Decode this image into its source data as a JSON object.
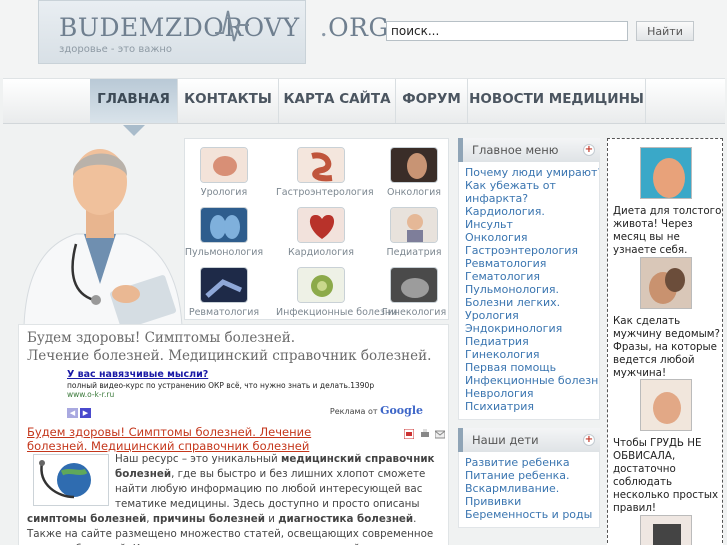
{
  "header": {
    "logo_text": "BUDEMZDOROVY",
    "logo_suffix": "ORG",
    "slogan": "здоровье - это важно",
    "search_value": "поиск...",
    "search_button": "Найти"
  },
  "nav": {
    "items": [
      {
        "label": "ГЛАВНАЯ",
        "active": true
      },
      {
        "label": "КОНТАКТЫ",
        "active": false
      },
      {
        "label": "КАРТА САЙТА",
        "active": false
      },
      {
        "label": "ФОРУМ",
        "active": false
      },
      {
        "label": "НОВОСТИ МЕДИЦИНЫ",
        "active": false
      }
    ]
  },
  "categories": [
    {
      "label": "Урология",
      "icon": "urology-icon"
    },
    {
      "label": "Гастроэнтерология",
      "icon": "gastro-icon"
    },
    {
      "label": "Онкология",
      "icon": "oncology-icon"
    },
    {
      "label": "Пульмонология",
      "icon": "lungs-icon"
    },
    {
      "label": "Кардиология",
      "icon": "heart-icon"
    },
    {
      "label": "Педиатрия",
      "icon": "child-icon"
    },
    {
      "label": "Ревматология",
      "icon": "joint-icon"
    },
    {
      "label": "Инфекционные болезни",
      "icon": "virus-icon"
    },
    {
      "label": "Гинекология",
      "icon": "gynecology-icon"
    }
  ],
  "main": {
    "hero_title_line1": "Будем здоровы! Симптомы болезней.",
    "hero_title_line2": "Лечение болезней. Медицинский справочник болезней.",
    "ad": {
      "title": "У вас навязчивые мысли?",
      "text": "полный видео-курс по устранению ОКР всё, что нужно знать и делать.1390р",
      "url": "www.o-k-r.ru",
      "google_prefix": "Реклама от",
      "google_name": "Google"
    },
    "article_link": "Будем здоровы! Симптомы болезней. Лечение болезней. Медицинский справочник болезней",
    "body": {
      "p1": "Наш ресурс – это уникальный ",
      "b1": "медицинский справочник болезней",
      "p2": ", где вы быстро и без лишних хлопот сможете найти любую информацию по любой интересующей вас тематике медицины. Здесь доступно и просто описаны ",
      "b2": "симптомы болезней",
      "p3": ", ",
      "b3": "причины болезней",
      "p4": " и ",
      "b4": "диагностика болезней",
      "p5": ". Также на сайте размещено множество статей, освещающих современное лечение болезней. Кроме того, в нашем справочнике вы найдете полезную информацию для будущих и настоящих"
    }
  },
  "menu_main": {
    "title": "Главное меню",
    "items": [
      "Почему люди умирают?",
      "Как убежать от",
      "инфаркта?",
      "Кардиология.",
      "Инсульт",
      "Онкология",
      "Гастроэнтерология",
      "Ревматология",
      "Гематология",
      "Пульмонология.",
      "Болезни легких.",
      "Урология",
      "Эндокринология",
      "Педиатрия",
      "Гинекология",
      "Первая помощь",
      "Инфекционные болезни",
      "Неврология",
      "Психиатрия"
    ]
  },
  "menu_kids": {
    "title": "Наши дети",
    "items": [
      "Развитие ребенка",
      "Питание ребенка.",
      "Вскармливание.",
      "Прививки",
      "Беременность и роды"
    ]
  },
  "ads_column": [
    {
      "text": "Диета для толстого живота! Через месяц вы не узнаете себя."
    },
    {
      "text": "Как сделать мужчину ведомым? Фразы, на которые ведется любой мужчина!"
    },
    {
      "text": "Чтобы ГРУДЬ НЕ ОБВИСАЛА, достаточно соблюдать несколько простых правил!"
    }
  ]
}
